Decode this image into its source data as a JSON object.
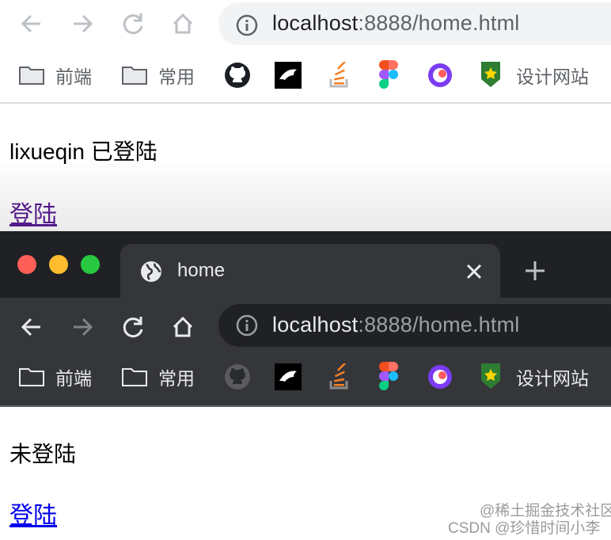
{
  "top_browser": {
    "address": {
      "host": "localhost",
      "path": ":8888/home.html"
    },
    "bookmarks": [
      "前端",
      "常用",
      "设计网站"
    ],
    "page": {
      "status_text": "lixueqin 已登陆",
      "link_text": "登陆"
    }
  },
  "bottom_browser": {
    "tab": {
      "title": "home"
    },
    "address": {
      "host": "localhost",
      "path": ":8888/home.html"
    },
    "bookmarks": [
      "前端",
      "常用",
      "设计网站"
    ],
    "page": {
      "status_text": "未登陆",
      "link_text": "登陆"
    }
  },
  "watermark": {
    "line1": "@稀土掘金技术社区",
    "line2": "CSDN @珍惜时间小李"
  },
  "colors": {
    "link_visited": "#551a8b",
    "link": "#0000ee",
    "dark_bg": "#202124",
    "dark_toolbar": "#35363a"
  }
}
